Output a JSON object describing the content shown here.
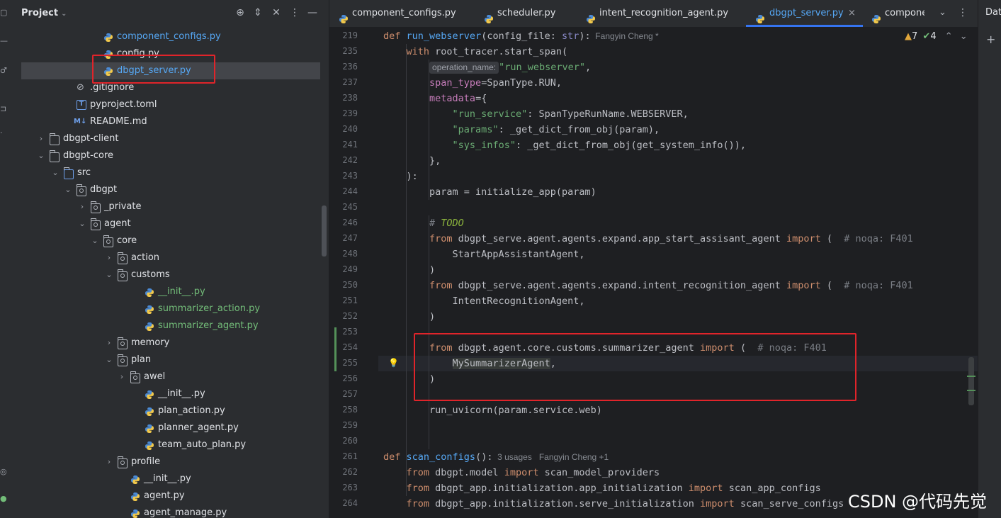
{
  "project_panel": {
    "title": "Project",
    "tree": [
      {
        "label": "component_configs.py",
        "icon": "python",
        "color": "#56a8f5"
      },
      {
        "label": "config.py",
        "icon": "python",
        "color": "#dfe1e5"
      },
      {
        "label": "dbgpt_server.py",
        "icon": "python",
        "color": "#56a8f5"
      },
      {
        "label": ".gitignore",
        "icon": "ignore",
        "color": "#dfe1e5"
      },
      {
        "label": "pyproject.toml",
        "icon": "toml",
        "color": "#dfe1e5"
      },
      {
        "label": "README.md",
        "icon": "markdown",
        "color": "#dfe1e5"
      },
      {
        "label": "dbgpt-client",
        "icon": "folder",
        "color": "#dfe1e5",
        "expanded": false
      },
      {
        "label": "dbgpt-core",
        "icon": "folder",
        "color": "#dfe1e5",
        "expanded": true
      },
      {
        "label": "src",
        "icon": "folder-src",
        "color": "#dfe1e5",
        "expanded": true
      },
      {
        "label": "dbgpt",
        "icon": "package",
        "color": "#dfe1e5",
        "expanded": true
      },
      {
        "label": "_private",
        "icon": "package",
        "color": "#dfe1e5",
        "expanded": false
      },
      {
        "label": "agent",
        "icon": "package",
        "color": "#dfe1e5",
        "expanded": true
      },
      {
        "label": "core",
        "icon": "package",
        "color": "#dfe1e5",
        "expanded": true
      },
      {
        "label": "action",
        "icon": "package",
        "color": "#dfe1e5",
        "expanded": false
      },
      {
        "label": "customs",
        "icon": "package",
        "color": "#dfe1e5",
        "expanded": true
      },
      {
        "label": "__init__.py",
        "icon": "python",
        "color": "#73bd79"
      },
      {
        "label": "summarizer_action.py",
        "icon": "python",
        "color": "#73bd79"
      },
      {
        "label": "summarizer_agent.py",
        "icon": "python",
        "color": "#73bd79"
      },
      {
        "label": "memory",
        "icon": "package",
        "color": "#dfe1e5",
        "expanded": false
      },
      {
        "label": "plan",
        "icon": "package",
        "color": "#dfe1e5",
        "expanded": true
      },
      {
        "label": "awel",
        "icon": "package",
        "color": "#dfe1e5",
        "expanded": false
      },
      {
        "label": "__init__.py",
        "icon": "python",
        "color": "#dfe1e5"
      },
      {
        "label": "plan_action.py",
        "icon": "python",
        "color": "#dfe1e5"
      },
      {
        "label": "planner_agent.py",
        "icon": "python",
        "color": "#dfe1e5"
      },
      {
        "label": "team_auto_plan.py",
        "icon": "python",
        "color": "#dfe1e5"
      },
      {
        "label": "profile",
        "icon": "package",
        "color": "#dfe1e5",
        "expanded": false
      },
      {
        "label": "__init__.py",
        "icon": "python",
        "color": "#dfe1e5"
      },
      {
        "label": "agent.py",
        "icon": "python",
        "color": "#dfe1e5"
      },
      {
        "label": "agent_manage.py",
        "icon": "python",
        "color": "#dfe1e5"
      }
    ]
  },
  "tabs": [
    {
      "label": "component_configs.py",
      "active": false,
      "color": "#56a8f5"
    },
    {
      "label": "scheduler.py",
      "active": false,
      "color": "#dfe1e5"
    },
    {
      "label": "intent_recognition_agent.py",
      "active": false,
      "color": "#dfe1e5"
    },
    {
      "label": "dbgpt_server.py",
      "active": true,
      "color": "#56a8f5"
    },
    {
      "label": "componer",
      "active": false,
      "color": "#dfe1e5"
    }
  ],
  "inspections": {
    "warnings": "7",
    "weak": "4"
  },
  "right_strip": {
    "label": "Dat"
  },
  "watermark": "CSDN @代码先觉",
  "colors": {
    "keyword": "#cf8e6d",
    "function": "#56a8f5",
    "string": "#6aab73",
    "param": "#c77dbb",
    "comment": "#7a7e85",
    "text": "#bcbec4",
    "builtin": "#8888c6"
  },
  "code": [
    {
      "num": "219",
      "tokens": [
        [
          "def ",
          "keyword"
        ],
        [
          "run_webserver",
          "function"
        ],
        [
          "(config_file: ",
          "text"
        ],
        [
          "str",
          "builtin"
        ],
        [
          "):",
          "text"
        ]
      ],
      "hint": "Fangyin Cheng *"
    },
    {
      "num": "235",
      "tokens": [
        [
          "    ",
          "text"
        ],
        [
          "with ",
          "keyword"
        ],
        [
          "root_tracer.start_span(",
          "text"
        ]
      ]
    },
    {
      "num": "236",
      "tokens": [
        [
          "        ",
          "text"
        ]
      ],
      "inlay": "operation_name:",
      "after": [
        [
          "\"run_webserver\"",
          "string"
        ],
        [
          ",",
          "text"
        ]
      ]
    },
    {
      "num": "237",
      "tokens": [
        [
          "        ",
          "text"
        ],
        [
          "span_type",
          "param"
        ],
        [
          "=SpanType.RUN,",
          "text"
        ]
      ]
    },
    {
      "num": "238",
      "tokens": [
        [
          "        ",
          "text"
        ],
        [
          "metadata",
          "param"
        ],
        [
          "={",
          "text"
        ]
      ]
    },
    {
      "num": "239",
      "tokens": [
        [
          "            ",
          "text"
        ],
        [
          "\"run_service\"",
          "string"
        ],
        [
          ": SpanTypeRunName.WEBSERVER,",
          "text"
        ]
      ]
    },
    {
      "num": "240",
      "tokens": [
        [
          "            ",
          "text"
        ],
        [
          "\"params\"",
          "string"
        ],
        [
          ": _get_dict_from_obj(param),",
          "text"
        ]
      ]
    },
    {
      "num": "241",
      "tokens": [
        [
          "            ",
          "text"
        ],
        [
          "\"sys_infos\"",
          "string"
        ],
        [
          ": _get_dict_from_obj(get_system_info()),",
          "text"
        ]
      ]
    },
    {
      "num": "242",
      "tokens": [
        [
          "        },",
          "text"
        ]
      ]
    },
    {
      "num": "243",
      "tokens": [
        [
          "    ):",
          "text"
        ]
      ]
    },
    {
      "num": "244",
      "tokens": [
        [
          "        param = initialize_app(param)",
          "text"
        ]
      ]
    },
    {
      "num": "245",
      "tokens": []
    },
    {
      "num": "246",
      "tokens": [
        [
          "        ",
          "text"
        ],
        [
          "# ",
          "comment"
        ],
        [
          "TODO",
          "todo"
        ]
      ]
    },
    {
      "num": "247",
      "tokens": [
        [
          "        ",
          "text"
        ],
        [
          "from ",
          "keyword"
        ],
        [
          "dbgpt_serve.agent.agents.expand.app_start_assisant_agent ",
          "text"
        ],
        [
          "import ",
          "keyword"
        ],
        [
          "(  ",
          "text"
        ],
        [
          "# noqa: F401",
          "comment"
        ]
      ]
    },
    {
      "num": "248",
      "tokens": [
        [
          "            StartAppAssistantAgent,",
          "text"
        ]
      ]
    },
    {
      "num": "249",
      "tokens": [
        [
          "        )",
          "text"
        ]
      ]
    },
    {
      "num": "250",
      "tokens": [
        [
          "        ",
          "text"
        ],
        [
          "from ",
          "keyword"
        ],
        [
          "dbgpt_serve.agent.agents.expand.intent_recognition_agent ",
          "text"
        ],
        [
          "import ",
          "keyword"
        ],
        [
          "(  ",
          "text"
        ],
        [
          "# noqa: F401",
          "comment"
        ]
      ]
    },
    {
      "num": "251",
      "tokens": [
        [
          "            IntentRecognitionAgent,",
          "text"
        ]
      ]
    },
    {
      "num": "252",
      "tokens": [
        [
          "        )",
          "text"
        ]
      ]
    },
    {
      "num": "253",
      "tokens": []
    },
    {
      "num": "254",
      "tokens": [
        [
          "        ",
          "text"
        ],
        [
          "from ",
          "keyword"
        ],
        [
          "dbgpt.agent.core.customs.summarizer_agent ",
          "text"
        ],
        [
          "import ",
          "keyword"
        ],
        [
          "(  ",
          "text"
        ],
        [
          "# noqa: F401",
          "comment"
        ]
      ]
    },
    {
      "num": "255",
      "tokens": [
        [
          "            ",
          "text"
        ],
        [
          "MySummarizerAgent",
          "selword"
        ],
        [
          ",",
          "text"
        ]
      ]
    },
    {
      "num": "256",
      "tokens": [
        [
          "        )",
          "text"
        ]
      ]
    },
    {
      "num": "257",
      "tokens": []
    },
    {
      "num": "258",
      "tokens": [
        [
          "        run_uvicorn(param.service.web)",
          "text"
        ]
      ]
    },
    {
      "num": "259",
      "tokens": []
    },
    {
      "num": "260",
      "tokens": []
    },
    {
      "num": "261",
      "tokens": [
        [
          "def ",
          "keyword"
        ],
        [
          "scan_configs",
          "function"
        ],
        [
          "():",
          "text"
        ]
      ],
      "hint": "3 usages   Fangyin Cheng +1"
    },
    {
      "num": "262",
      "tokens": [
        [
          "    ",
          "text"
        ],
        [
          "from ",
          "keyword"
        ],
        [
          "dbgpt.model ",
          "text"
        ],
        [
          "import ",
          "keyword"
        ],
        [
          "scan_model_providers",
          "text"
        ]
      ]
    },
    {
      "num": "263",
      "tokens": [
        [
          "    ",
          "text"
        ],
        [
          "from ",
          "keyword"
        ],
        [
          "dbgpt_app.initialization.app_initialization ",
          "text"
        ],
        [
          "import ",
          "keyword"
        ],
        [
          "scan_app_configs",
          "text"
        ]
      ]
    },
    {
      "num": "264",
      "tokens": [
        [
          "    ",
          "text"
        ],
        [
          "from ",
          "keyword"
        ],
        [
          "dbgpt_app.initialization.serve_initialization ",
          "text"
        ],
        [
          "import ",
          "keyword"
        ],
        [
          "scan_serve_configs",
          "text"
        ]
      ]
    }
  ]
}
